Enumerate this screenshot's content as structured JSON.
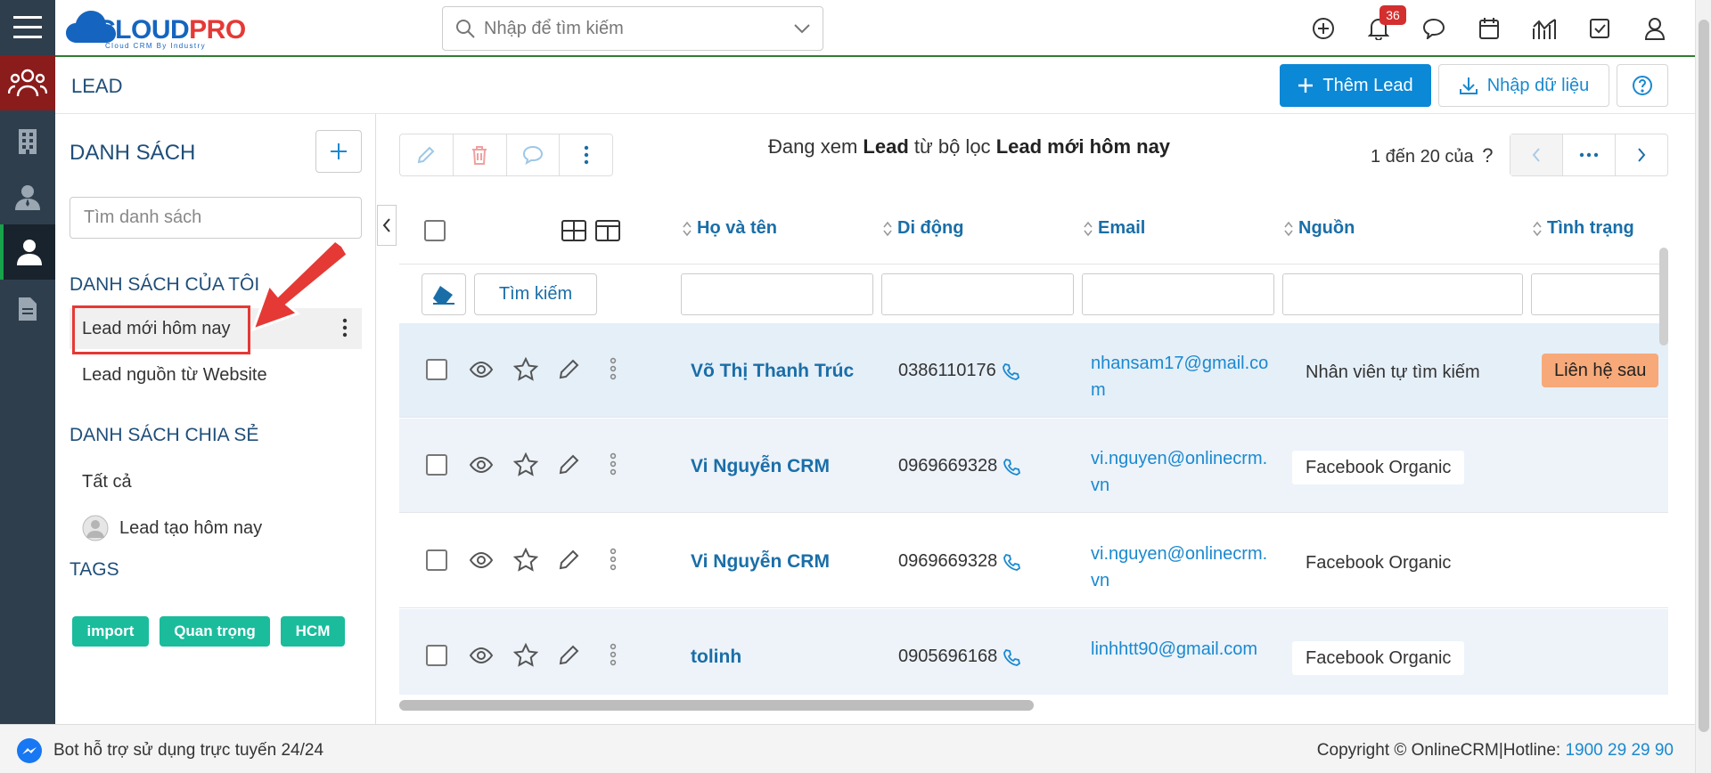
{
  "app": {
    "logo_text_1": "CLOUD",
    "logo_text_2": "PRO",
    "logo_tagline": "Cloud CRM By Industry"
  },
  "header": {
    "search_placeholder": "Nhập để tìm kiếm",
    "notification_count": "36"
  },
  "page": {
    "title": "LEAD",
    "add_button": "Thêm Lead",
    "import_button": "Nhập dữ liệu"
  },
  "list_panel": {
    "title": "DANH SÁCH",
    "search_placeholder": "Tìm danh sách",
    "my_lists_heading": "DANH SÁCH CỦA TÔI",
    "my_lists": [
      "Lead mới hôm nay",
      "Lead nguồn từ Website"
    ],
    "shared_heading": "DANH SÁCH CHIA SẺ",
    "shared_lists": [
      "Tất cả",
      "Lead tạo hôm nay"
    ],
    "tags_heading": "TAGS",
    "tags": [
      "import",
      "Quan trọng",
      "HCM"
    ]
  },
  "toolbar": {
    "viewing_prefix": "Đang xem",
    "viewing_module": "Lead",
    "viewing_mid": "từ bộ lọc",
    "viewing_filter": "Lead mới hôm nay",
    "paging_text": "1 đến 20 của",
    "paging_unknown": "?"
  },
  "table": {
    "columns": [
      "Họ và tên",
      "Di động",
      "Email",
      "Nguồn",
      "Tình trạng"
    ],
    "search_button": "Tìm kiếm",
    "rows": [
      {
        "name": "Võ Thị Thanh Trúc",
        "phone": "0386110176",
        "email": "nhansam17@gmail.com",
        "source": "Nhân viên tự tìm kiếm",
        "status": "Liên hệ sau"
      },
      {
        "name": "Vi Nguyễn CRM",
        "phone": "0969669328",
        "email": "vi.nguyen@onlinecrm.vn",
        "source": "Facebook Organic",
        "status": ""
      },
      {
        "name": "Vi Nguyễn CRM",
        "phone": "0969669328",
        "email": "vi.nguyen@onlinecrm.vn",
        "source": "Facebook Organic",
        "status": ""
      },
      {
        "name": "tolinh",
        "phone": "0905696168",
        "email": "linhhtt90@gmail.com",
        "source": "Facebook Organic",
        "status": ""
      }
    ]
  },
  "footer": {
    "bot_text": "Bot hỗ trợ sử dụng trực tuyến 24/24",
    "copyright": "Copyright © OnlineCRM|Hotline: ",
    "hotline": "1900 29 29 90"
  },
  "colors": {
    "rail": "#2f3e4c",
    "primary": "#0b88d6",
    "heading": "#1f4e79",
    "tag": "#1abc9c",
    "status": "#f7a979",
    "highlight": "#e53935"
  },
  "icons": {
    "hamburger": "menu-icon",
    "leads": "users-icon",
    "organization": "building-icon",
    "contact": "contact-icon",
    "person": "person-icon",
    "document": "document-icon"
  }
}
